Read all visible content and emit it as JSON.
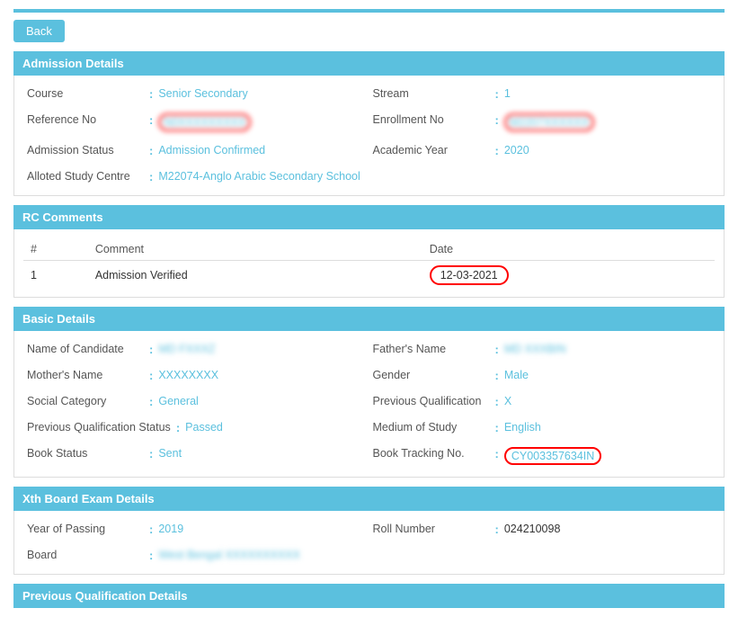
{
  "topBar": {
    "color": "#5bc0de"
  },
  "buttons": {
    "back": "Back"
  },
  "admissionDetails": {
    "header": "Admission Details",
    "fields": {
      "course_label": "Course",
      "course_value": "Senior Secondary",
      "stream_label": "Stream",
      "stream_value": "1",
      "reference_no_label": "Reference No",
      "reference_no_value": "N0XXXXXXXXX",
      "enrollment_no_label": "Enrollment No",
      "enrollment_no_value": "M2207XXXXXX",
      "admission_status_label": "Admission Status",
      "admission_status_value": "Admission Confirmed",
      "academic_year_label": "Academic Year",
      "academic_year_value": "2020",
      "alloted_study_centre_label": "Alloted Study Centre",
      "alloted_study_centre_value": "M22074-Anglo Arabic Secondary School"
    }
  },
  "rcComments": {
    "header": "RC Comments",
    "columns": [
      "#",
      "Comment",
      "Date"
    ],
    "rows": [
      {
        "num": "1",
        "comment": "Admission Verified",
        "date": "12-03-2021"
      }
    ]
  },
  "basicDetails": {
    "header": "Basic Details",
    "fields": {
      "name_label": "Name of Candidate",
      "name_value": "MD FXXXZ",
      "fathers_name_label": "Father's Name",
      "fathers_name_value": "MD XXXBIN",
      "mothers_name_label": "Mother's Name",
      "mothers_name_value": "XXXXXXXX",
      "gender_label": "Gender",
      "gender_value": "Male",
      "social_category_label": "Social Category",
      "social_category_value": "General",
      "previous_qualification_label": "Previous Qualification",
      "previous_qualification_value": "X",
      "prev_qual_status_label": "Previous Qualification Status",
      "prev_qual_status_value": "Passed",
      "medium_of_study_label": "Medium of Study",
      "medium_of_study_value": "English",
      "book_status_label": "Book Status",
      "book_status_value": "Sent",
      "book_tracking_label": "Book Tracking No.",
      "book_tracking_value": "CY003357634IN"
    }
  },
  "xthBoardExam": {
    "header": "Xth Board Exam Details",
    "fields": {
      "year_of_passing_label": "Year of Passing",
      "year_of_passing_value": "2019",
      "roll_number_label": "Roll Number",
      "roll_number_value": "024210098",
      "board_label": "Board",
      "board_value": "West Bengal XXXXXXXXXX"
    }
  },
  "previousQualification": {
    "header": "Previous Qualification Details"
  }
}
